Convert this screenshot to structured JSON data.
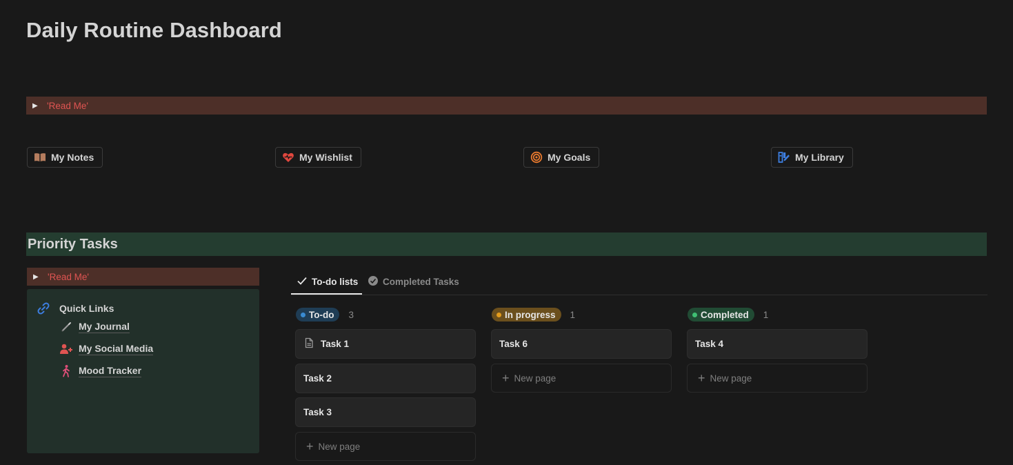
{
  "page": {
    "title": "Daily Routine Dashboard"
  },
  "readme_toggle": {
    "label": "'Read Me'"
  },
  "links": [
    {
      "label": "My Notes",
      "icon": "book-icon",
      "color": "#b57d5e"
    },
    {
      "label": "My Wishlist",
      "icon": "heart-icon",
      "color": "#e0473e"
    },
    {
      "label": "My Goals",
      "icon": "target-icon",
      "color": "#e8792e"
    },
    {
      "label": "My Library",
      "icon": "library-icon",
      "color": "#3d7ee0"
    }
  ],
  "priority": {
    "heading": "Priority Tasks",
    "readme_label": "'Read Me'",
    "quick_links": {
      "title": "Quick Links",
      "items": [
        {
          "label": "My Journal",
          "icon": "pen-icon"
        },
        {
          "label": "My Social Media",
          "icon": "add-user-icon",
          "color": "#df5452"
        },
        {
          "label": "Mood Tracker",
          "icon": "walking-person-icon",
          "color": "#df4f79"
        }
      ]
    }
  },
  "board": {
    "tabs": [
      {
        "label": "To-do lists",
        "active": true
      },
      {
        "label": "Completed Tasks",
        "active": false
      }
    ],
    "columns": [
      {
        "status": "To-do",
        "count": "3",
        "pill_bg": "#1f3d55",
        "dot": "#3a8bd1",
        "cards": [
          "Task 1",
          "Task 2",
          "Task 3"
        ],
        "new_label": "New page"
      },
      {
        "status": "In progress",
        "count": "1",
        "pill_bg": "#6b4f1d",
        "dot": "#e39b1c",
        "cards": [
          "Task 6"
        ],
        "new_label": "New page"
      },
      {
        "status": "Completed",
        "count": "1",
        "pill_bg": "#214b34",
        "dot": "#3fbf73",
        "cards": [
          "Task 4"
        ],
        "new_label": "New page"
      }
    ]
  }
}
